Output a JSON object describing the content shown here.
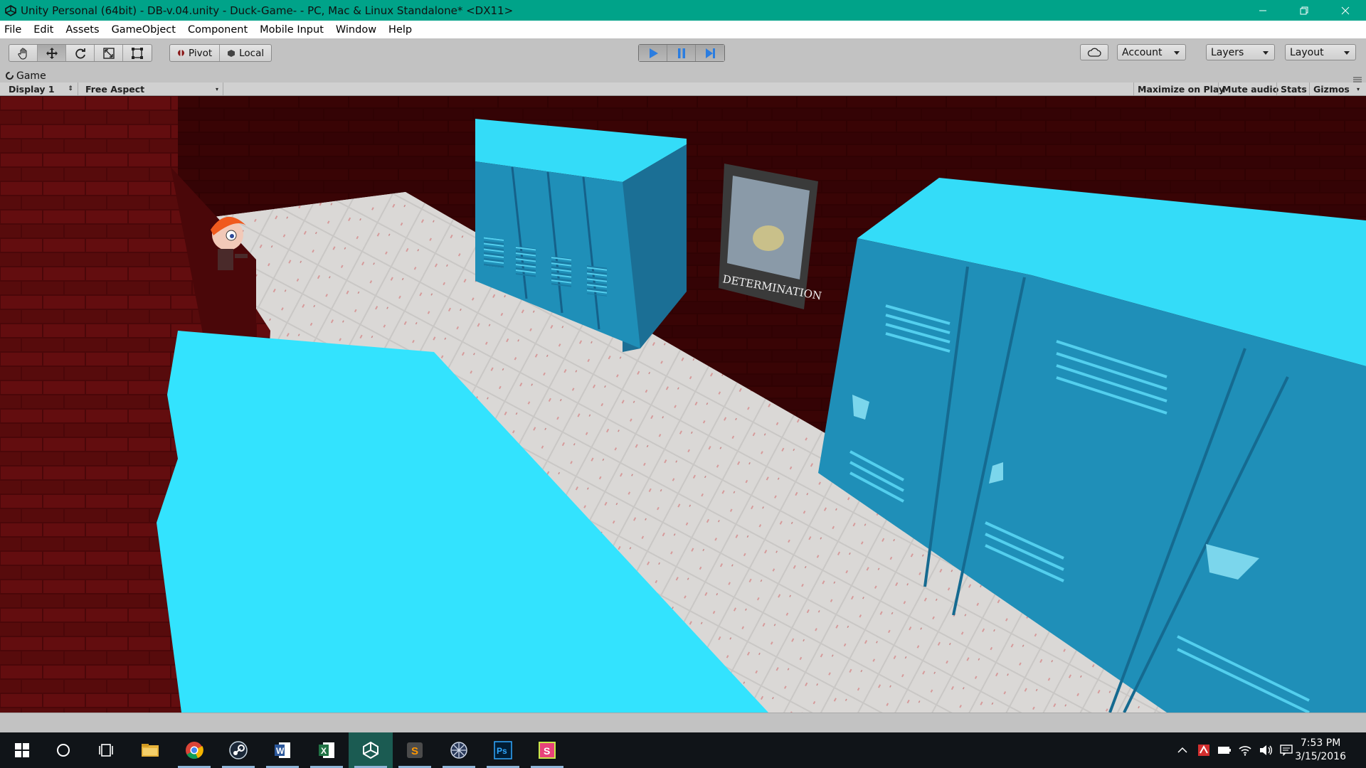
{
  "window": {
    "title": "Unity Personal (64bit) - DB-v.04.unity - Duck-Game- - PC, Mac & Linux Standalone* <DX11>",
    "controls": [
      "minimize",
      "restore",
      "close"
    ]
  },
  "menu": {
    "items": [
      "File",
      "Edit",
      "Assets",
      "GameObject",
      "Component",
      "Mobile Input",
      "Window",
      "Help"
    ]
  },
  "toolbar": {
    "transform_tools": [
      "hand-icon",
      "move-icon",
      "rotate-icon",
      "scale-icon",
      "rect-icon"
    ],
    "pivot_label": "Pivot",
    "local_label": "Local",
    "playback": [
      "play-icon",
      "pause-icon",
      "step-icon"
    ],
    "account_label": "Account",
    "layers_label": "Layers",
    "layout_label": "Layout"
  },
  "game_panel": {
    "tab_label": "Game",
    "display_label": "Display 1",
    "aspect_label": "Free Aspect",
    "maximize_label": "Maximize on Play",
    "mute_label": "Mute audio",
    "stats_label": "Stats",
    "gizmos_label": "Gizmos"
  },
  "scene": {
    "poster_text": "DETERMINATION",
    "colors": {
      "wall_brick": "#3d0405",
      "floor": "#d9d7d5",
      "locker": "#1f8fb8",
      "locker_top": "#34dcf8",
      "table": "#33e3fe"
    }
  },
  "taskbar": {
    "apps": [
      "start-icon",
      "cortana-icon",
      "task-view-icon",
      "file-explorer-icon",
      "chrome-icon",
      "steam-icon",
      "word-icon",
      "excel-icon",
      "unity-icon",
      "sublime-icon",
      "network-app-icon",
      "photoshop-icon",
      "snagit-icon"
    ],
    "time": "7:53 PM",
    "date": "3/15/2016"
  },
  "colors": {
    "titlebar": "#00a389",
    "editor_gray": "#c2c2c2",
    "taskbar": "#101418",
    "play_active": "#2b7de0"
  }
}
